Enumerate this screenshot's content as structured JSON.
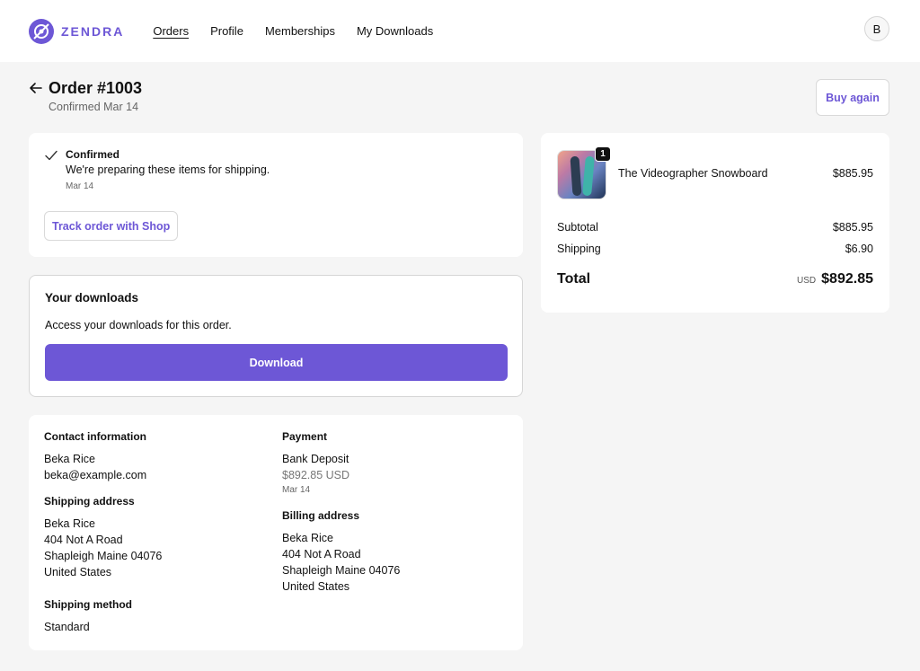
{
  "brand": {
    "name": "ZENDRA",
    "color": "#6d57d6"
  },
  "nav": [
    {
      "label": "Orders",
      "active": true
    },
    {
      "label": "Profile",
      "active": false
    },
    {
      "label": "Memberships",
      "active": false
    },
    {
      "label": "My Downloads",
      "active": false
    }
  ],
  "user": {
    "initial": "B"
  },
  "order": {
    "title": "Order #1003",
    "subtitle": "Confirmed Mar 14",
    "buy_again_label": "Buy again"
  },
  "status": {
    "icon": "check-icon",
    "label": "Confirmed",
    "message": "We're preparing these items for shipping.",
    "date": "Mar 14",
    "track_label": "Track order with Shop"
  },
  "downloads": {
    "title": "Your downloads",
    "description": "Access your downloads for this order.",
    "button_label": "Download"
  },
  "contact": {
    "label": "Contact information",
    "name": "Beka Rice",
    "email": "beka@example.com"
  },
  "shipping_address": {
    "label": "Shipping address",
    "lines": [
      "Beka Rice",
      "404 Not A Road",
      "Shapleigh Maine 04076",
      "United States"
    ]
  },
  "shipping_method": {
    "label": "Shipping method",
    "value": "Standard"
  },
  "payment": {
    "label": "Payment",
    "method": "Bank Deposit",
    "amount": "$892.85 USD",
    "date": "Mar 14"
  },
  "billing_address": {
    "label": "Billing address",
    "lines": [
      "Beka Rice",
      "404 Not A Road",
      "Shapleigh Maine 04076",
      "United States"
    ]
  },
  "summary": {
    "item": {
      "name": "The Videographer Snowboard",
      "price": "$885.95",
      "quantity": "1"
    },
    "subtotal_label": "Subtotal",
    "subtotal": "$885.95",
    "shipping_label": "Shipping",
    "shipping": "$6.90",
    "total_label": "Total",
    "currency": "USD",
    "total": "$892.85"
  }
}
